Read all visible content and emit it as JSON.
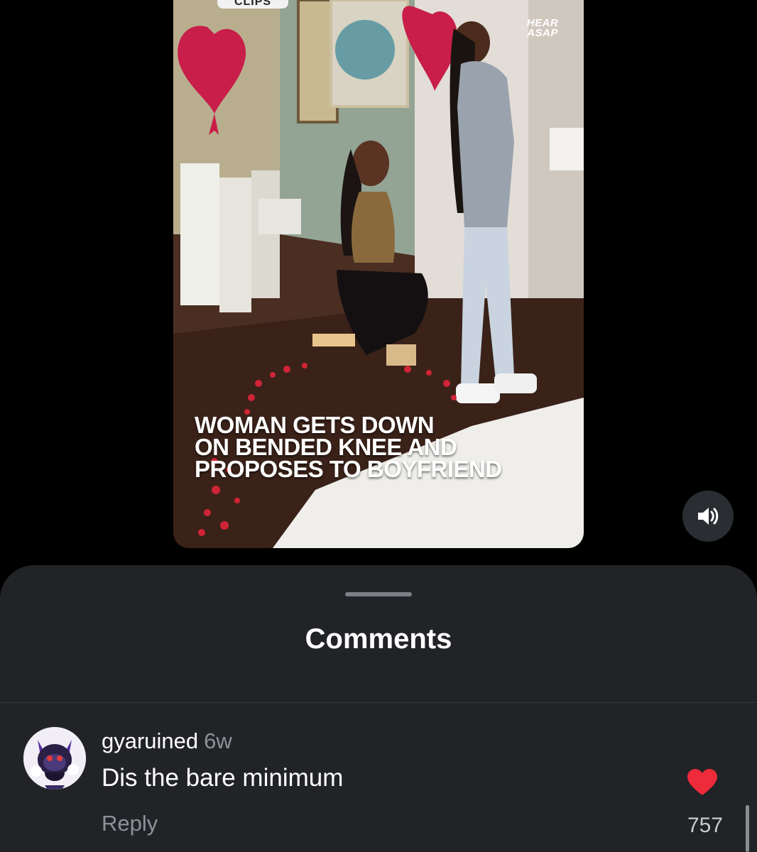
{
  "video": {
    "tab_label": "CLIPS",
    "brand_line1": "HEAR",
    "brand_line2": "ASAP",
    "caption_lines": [
      "WOMAN GETS DOWN",
      "ON BENDED KNEE AND",
      "PROPOSES TO BOYFRIEND"
    ],
    "volume_icon": "speaker-volume-icon"
  },
  "sheet": {
    "title": "Comments"
  },
  "comment": {
    "username": "gyaruined",
    "time": "6w",
    "text": "Dis the bare minimum",
    "reply_label": "Reply",
    "like_count": "757",
    "liked": true,
    "like_color": "#ee2b3a"
  },
  "colors": {
    "background": "#000000",
    "sheet": "#212327",
    "secondary_text": "#8d9197"
  }
}
